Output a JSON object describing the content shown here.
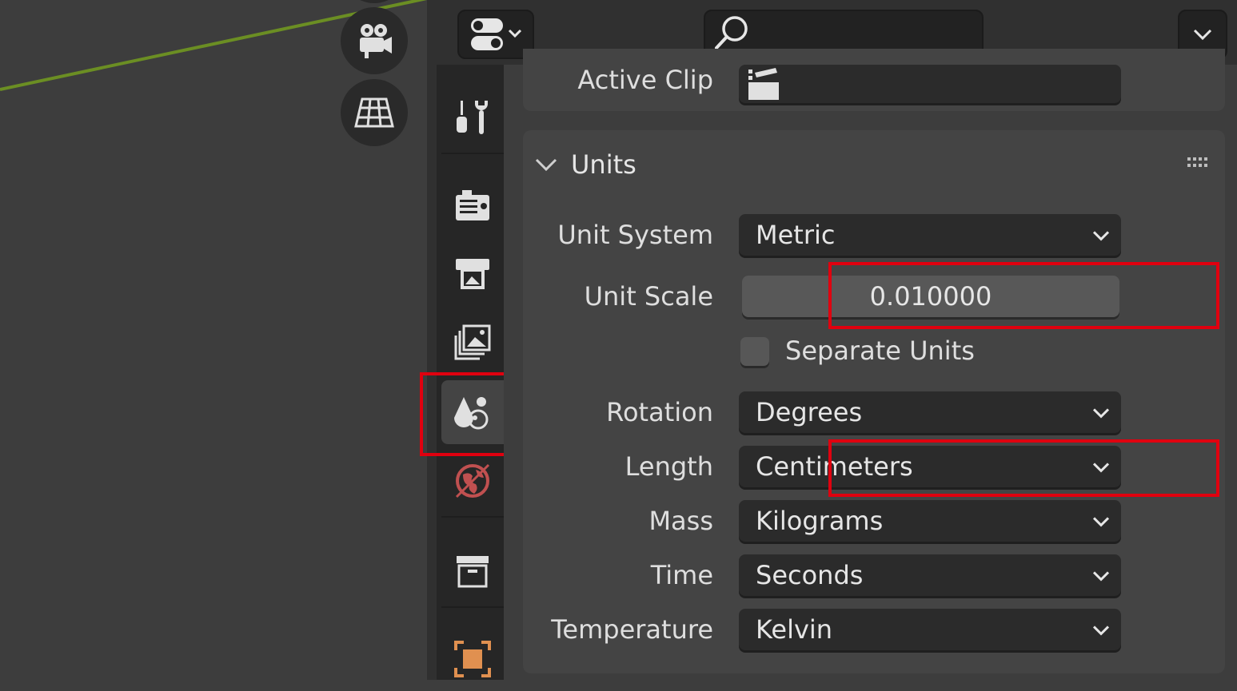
{
  "header": {
    "search_placeholder": ""
  },
  "active_clip": {
    "label": "Active Clip",
    "value": ""
  },
  "units": {
    "title": "Units",
    "unit_system": {
      "label": "Unit System",
      "value": "Metric"
    },
    "unit_scale": {
      "label": "Unit Scale",
      "value": "0.010000"
    },
    "separate_units": {
      "label": "Separate Units",
      "checked": false
    },
    "rotation": {
      "label": "Rotation",
      "value": "Degrees"
    },
    "length": {
      "label": "Length",
      "value": "Centimeters"
    },
    "mass": {
      "label": "Mass",
      "value": "Kilograms"
    },
    "time": {
      "label": "Time",
      "value": "Seconds"
    },
    "temperature": {
      "label": "Temperature",
      "value": "Kelvin"
    }
  },
  "tabs": [
    {
      "name": "tool",
      "icon": "tool-icon",
      "active": false
    },
    {
      "name": "render",
      "icon": "render-icon",
      "active": false
    },
    {
      "name": "output",
      "icon": "output-icon",
      "active": false
    },
    {
      "name": "view-layer",
      "icon": "view-layer-icon",
      "active": false
    },
    {
      "name": "scene",
      "icon": "scene-icon",
      "active": true
    },
    {
      "name": "world",
      "icon": "world-icon",
      "active": false
    },
    {
      "name": "collection",
      "icon": "collection-icon",
      "active": false
    },
    {
      "name": "object",
      "icon": "object-icon",
      "active": false
    }
  ],
  "colors": {
    "highlight": "#e0000f",
    "axis_line": "#6b8e23",
    "world_icon": "#c05050",
    "object_icon": "#e09050"
  }
}
